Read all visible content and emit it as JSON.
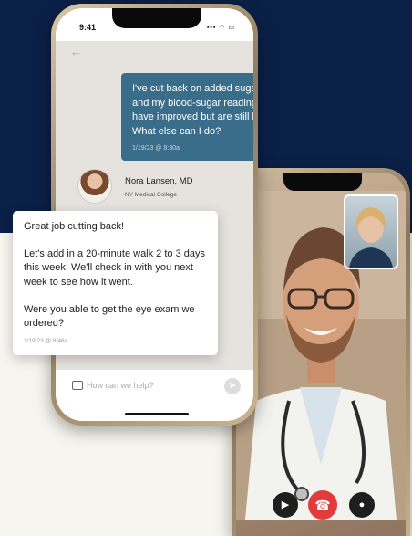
{
  "status_bar": {
    "time": "9:41",
    "icons": "▪▪▪ ◠ ▭"
  },
  "chat": {
    "patient_message": {
      "text": "I've cut back on added sugars, and my blood-sugar readings have improved but are still high. What else can I do?",
      "timestamp": "1/19/23 @ 8:30a"
    },
    "doctor": {
      "name": "Nora Lansen, MD",
      "organization": "NY Medical College"
    },
    "doctor_reply": {
      "paragraphs": [
        "Great job cutting back!",
        "Let's add in a 20-minute walk 2 to 3 days this week. We'll check in with you next week to see how it went.",
        "Were you able to get the eye exam we ordered?"
      ],
      "timestamp": "1/19/23 @ 8:46a"
    },
    "input": {
      "placeholder": "How can we help?"
    }
  },
  "icons": {
    "back": "back-arrow-icon",
    "camera": "camera-icon",
    "send": "send-icon",
    "video": "video-icon",
    "end_call": "end-call-icon",
    "mic": "microphone-icon"
  },
  "colors": {
    "background_dark": "#0b2047",
    "patient_bubble": "#3a6d8a",
    "accent_back": "#d7a13f",
    "end_call": "#e23b3b"
  }
}
